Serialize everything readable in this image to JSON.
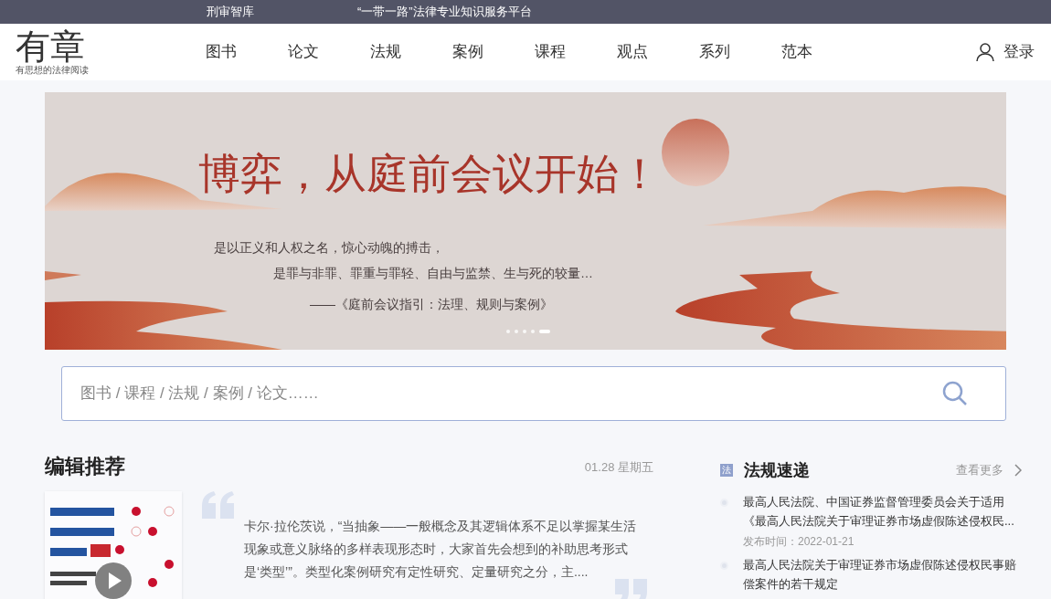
{
  "top_bar": {
    "links": [
      "刑审智库",
      "“一带一路”法律专业知识服务平台"
    ]
  },
  "logo": {
    "title": "有章",
    "tagline": "有思想的法律阅读"
  },
  "nav": [
    {
      "label": "图书"
    },
    {
      "label": "论文"
    },
    {
      "label": "法规"
    },
    {
      "label": "案例"
    },
    {
      "label": "课程"
    },
    {
      "label": "观点"
    },
    {
      "label": "系列"
    },
    {
      "label": "范本"
    }
  ],
  "login": "登录",
  "banner": {
    "headline": "博弈，从庭前会议开始！",
    "lines": [
      "是以正义和人权之名，惊心动魄的搏击，",
      "是罪与非罪、罪重与罪轻、自由与监禁、生与死的较量…"
    ],
    "source": "——《庭前会议指引：法理、规则与案例》",
    "dots": [
      {
        "selected": false
      },
      {
        "selected": false
      },
      {
        "selected": false
      },
      {
        "selected": false
      },
      {
        "selected": true
      }
    ]
  },
  "search": {
    "placeholder": "图书 / 课程 / 法规 / 案例 / 论文……"
  },
  "editor_picks": {
    "title": "编辑推荐",
    "date": "01.28 星期五",
    "excerpt": "卡尔·拉伦茨说，“当抽象——一般概念及其逻辑体系不足以掌握某生活现象或意义脉络的多样表现形态时，大家首先会想到的补助思考形式是‘类型’”。类型化案例研究有定性研究、定量研究之分，主...."
  },
  "regulations": {
    "badge": "法",
    "title": "法规速递",
    "more": "查看更多",
    "items": [
      {
        "title": "最高人民法院、中国证券监督管理委员会关于适用《最高人民法院关于审理证券市场虚假陈述侵权民...",
        "date": "发布时间：2022-01-21"
      },
      {
        "title": "最高人民法院关于审理证券市场虚假陈述侵权民事赔偿案件的若干规定"
      }
    ]
  }
}
